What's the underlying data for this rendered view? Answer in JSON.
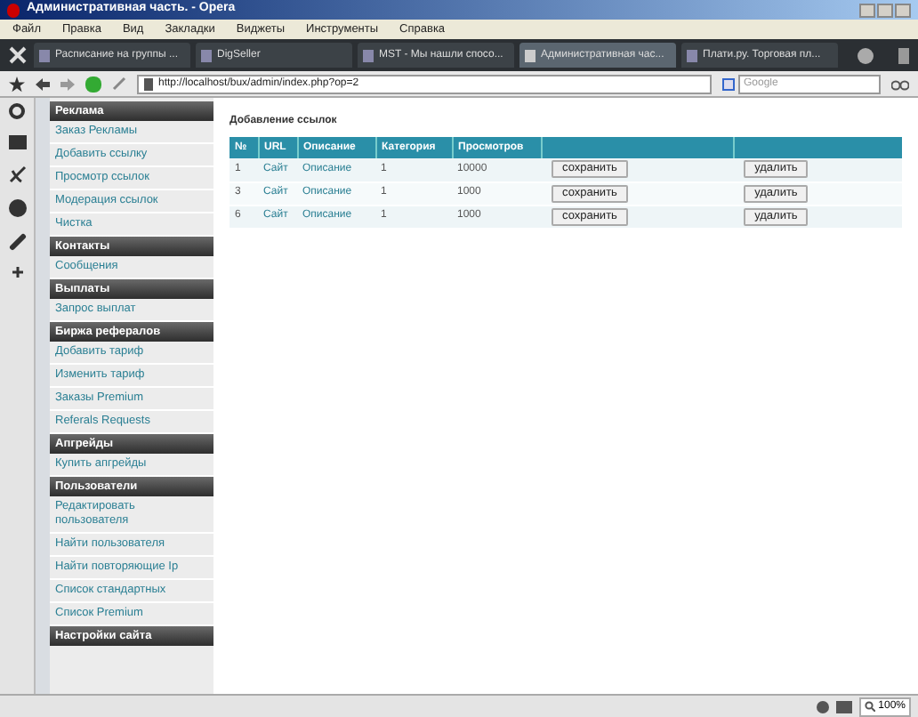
{
  "window": {
    "title": "Административная часть. - Opera"
  },
  "menu": [
    "Файл",
    "Правка",
    "Вид",
    "Закладки",
    "Виджеты",
    "Инструменты",
    "Справка"
  ],
  "tabs": [
    {
      "label": "Расписание на группы ...",
      "selected": false
    },
    {
      "label": "DigSeller",
      "selected": false
    },
    {
      "label": "MST - Мы нашли спосо...",
      "selected": false
    },
    {
      "label": "Административная час...",
      "selected": true
    },
    {
      "label": "Плати.ру. Торговая пл...",
      "selected": false
    }
  ],
  "address": {
    "url": "http://localhost/bux/admin/index.php?op=2"
  },
  "search": {
    "placeholder": "Google"
  },
  "sidebar": [
    {
      "title": "Реклама",
      "items": [
        "Заказ Рекламы",
        "Добавить ссылку",
        "Просмотр ссылок",
        "Модерация ссылок",
        "Чистка"
      ]
    },
    {
      "title": "Контакты",
      "items": [
        "Сообщения"
      ]
    },
    {
      "title": "Выплаты",
      "items": [
        "Запрос выплат"
      ]
    },
    {
      "title": "Биржа рефералов",
      "items": [
        "Добавить тариф",
        "Изменить тариф",
        "Заказы Premium",
        "Referals Requests"
      ]
    },
    {
      "title": "Апгрейды",
      "items": [
        "Купить апгрейды"
      ]
    },
    {
      "title": "Пользователи",
      "items": [
        "Редактировать пользователя",
        "Найти пользователя",
        "Найти повторяющие Ip",
        "Список стандартных",
        "Список Premium"
      ]
    },
    {
      "title": "Настройки сайта"
    }
  ],
  "content": {
    "title": "Добавление ссылок",
    "table": {
      "columns": [
        "№",
        "URL",
        "Описание",
        "Категория",
        "Просмотров"
      ],
      "rows": [
        {
          "cells": [
            "1",
            "Сайт",
            "Описание",
            "1",
            "10000"
          ],
          "save": "сохранить",
          "delete": "удалить"
        },
        {
          "cells": [
            "3",
            "Сайт",
            "Описание",
            "1",
            "1000"
          ],
          "save": "сохранить",
          "delete": "удалить"
        },
        {
          "cells": [
            "6",
            "Сайт",
            "Описание",
            "1",
            "1000"
          ],
          "save": "сохранить",
          "delete": "удалить"
        }
      ]
    }
  },
  "status_bar": {
    "zoom": "100%"
  }
}
